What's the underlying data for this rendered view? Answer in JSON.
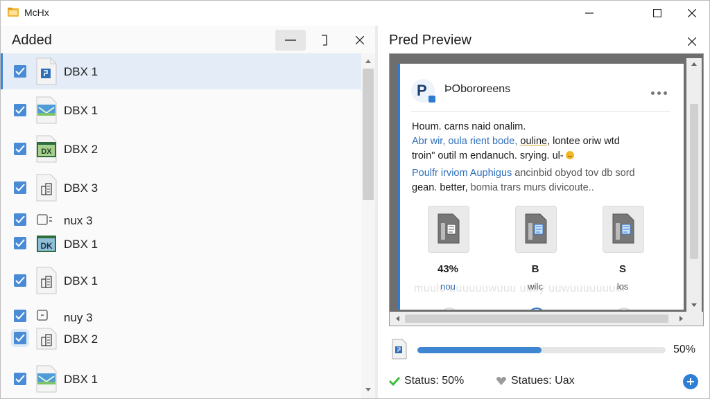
{
  "window": {
    "title": "McHx"
  },
  "left_panel": {
    "title": "Added",
    "items": [
      {
        "label": "DBX 1",
        "icon": "document-icon",
        "checked": true,
        "selected": true
      },
      {
        "label": "DBX 1",
        "icon": "envelope-image-icon",
        "checked": true
      },
      {
        "label": "DBX 2",
        "icon": "dx-image-icon",
        "icon_text": "DX",
        "checked": true
      },
      {
        "label": "DBX 3",
        "icon": "building-document-icon",
        "checked": true
      },
      {
        "label": "nux 3",
        "icon": "small-box-icon",
        "checked": true
      },
      {
        "label": "DBX 1",
        "icon": "dk-image-icon",
        "icon_text": "DK",
        "checked": true
      },
      {
        "label": "DBX 1",
        "icon": "building-document-icon",
        "checked": true
      },
      {
        "label": "nuy 3",
        "icon": "small-box-icon",
        "checked": true
      },
      {
        "label": "DBX 2",
        "icon": "building-document-icon",
        "checked": true
      },
      {
        "label": "DBX 1",
        "icon": "envelope-image-icon",
        "checked": true
      }
    ]
  },
  "preview_panel": {
    "title": "Pred Preview",
    "post": {
      "avatar_letter": "P",
      "name": "ÞObororeens",
      "lines": [
        {
          "text": "Houm. carns naid onalim.",
          "color": "dark"
        },
        {
          "text": "Abr wir, oula rient bode, ",
          "underlined": "ouline",
          "rest": ", lontee oriw wtd",
          "color": "blue"
        },
        {
          "text": "troin\" outil m endanuch. srying. ul-",
          "color": "dark"
        },
        {
          "text": "Poulfr irviom  Auphigus",
          "rest": "  ancinbid  obyod tov db sord",
          "color": "blue"
        },
        {
          "text": "gean. better,",
          "rest": " bomia trars murs divicoute..",
          "color": "dark"
        }
      ],
      "tiles": [
        {
          "caption": "43%",
          "sub": "nou"
        },
        {
          "caption": "B",
          "sub": "wilc"
        },
        {
          "caption": "S",
          "sub": "los"
        }
      ],
      "ghost_text": "muulu uuuuuuwuuu uuuy uuwuuuuuuuei"
    },
    "progress": {
      "value": 0.5,
      "label": "50%"
    },
    "status_left": "Status: 50%",
    "status_right": "Statues: Uax"
  },
  "colors": {
    "accent": "#3b82d4",
    "selected_row": "#e3ecf7",
    "status_ok": "#3bbf3b"
  }
}
